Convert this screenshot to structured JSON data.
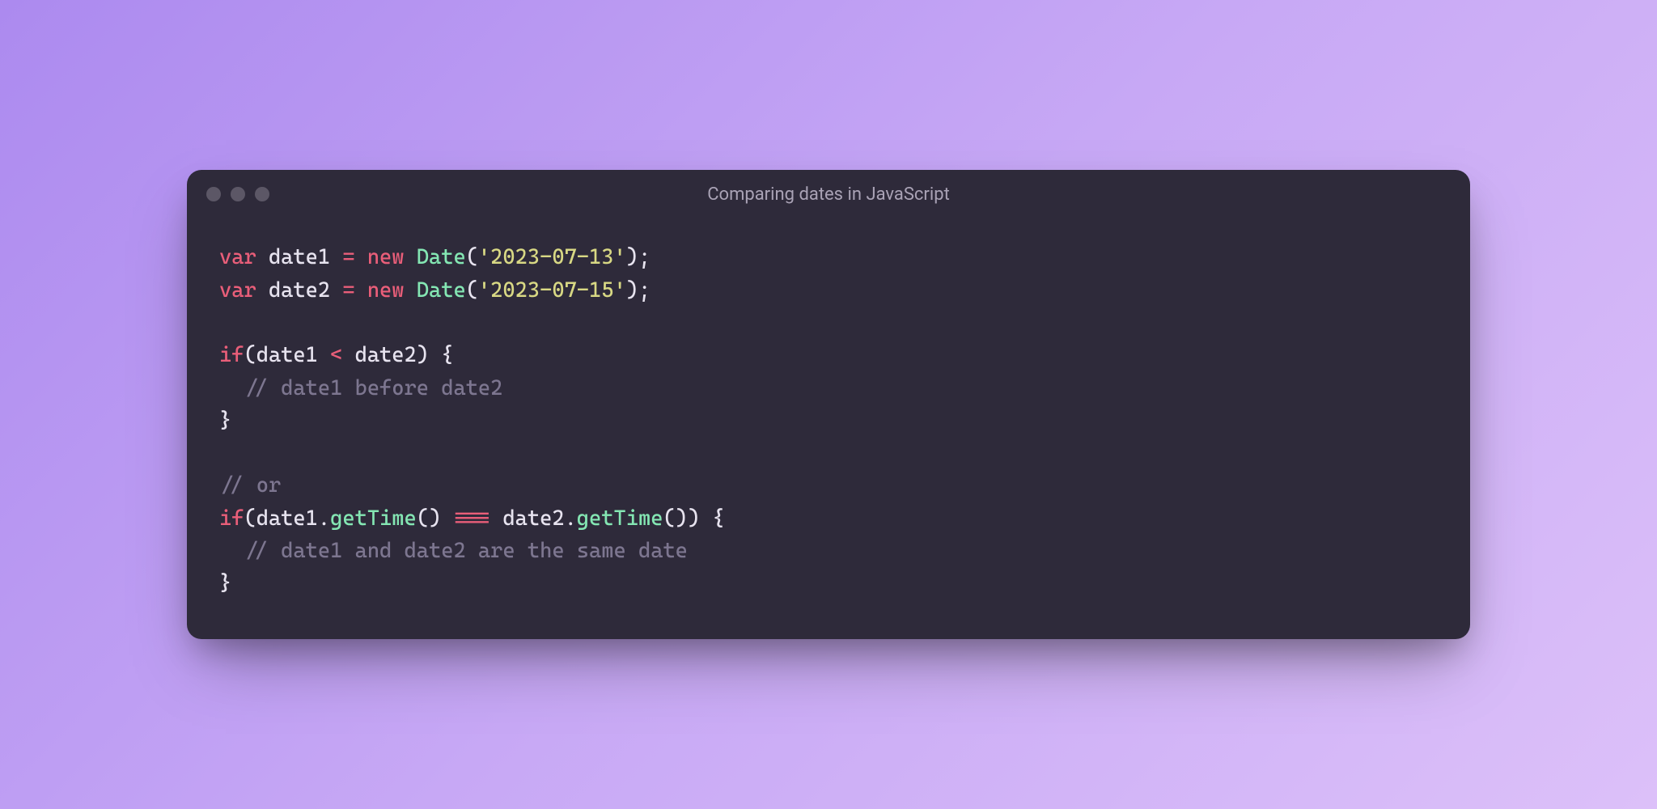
{
  "window": {
    "title": "Comparing dates in JavaScript"
  },
  "code": {
    "kw_var1": "var",
    "id_date1_a": "date1",
    "op_eq1": "=",
    "kw_new1": "new",
    "cls_date1": "Date",
    "paren_o1": "(",
    "str_d1": "'2023-07-13'",
    "paren_c1": ")",
    "semi1": ";",
    "kw_var2": "var",
    "id_date2_a": "date2",
    "op_eq2": "=",
    "kw_new2": "new",
    "cls_date2": "Date",
    "paren_o2": "(",
    "str_d2": "'2023-07-15'",
    "paren_c2": ")",
    "semi2": ";",
    "kw_if1": "if",
    "paren_o3": "(",
    "id_date1_b": "date1",
    "op_lt": "<",
    "id_date2_b": "date2",
    "paren_c3": ")",
    "brace_o1": "{",
    "cmt_before": "// date1 before date2",
    "brace_c1": "}",
    "cmt_or": "// or",
    "kw_if2": "if",
    "paren_o4": "(",
    "id_date1_c": "date1",
    "dot1": ".",
    "m_gettime1": "getTime",
    "paren_o5": "(",
    "paren_c5": ")",
    "op_eqeqeq": "===",
    "id_date2_c": "date2",
    "dot2": ".",
    "m_gettime2": "getTime",
    "paren_o6": "(",
    "paren_c6": ")",
    "paren_c4": ")",
    "brace_o2": "{",
    "cmt_same": "// date1 and date2 are the same date",
    "brace_c2": "}"
  }
}
